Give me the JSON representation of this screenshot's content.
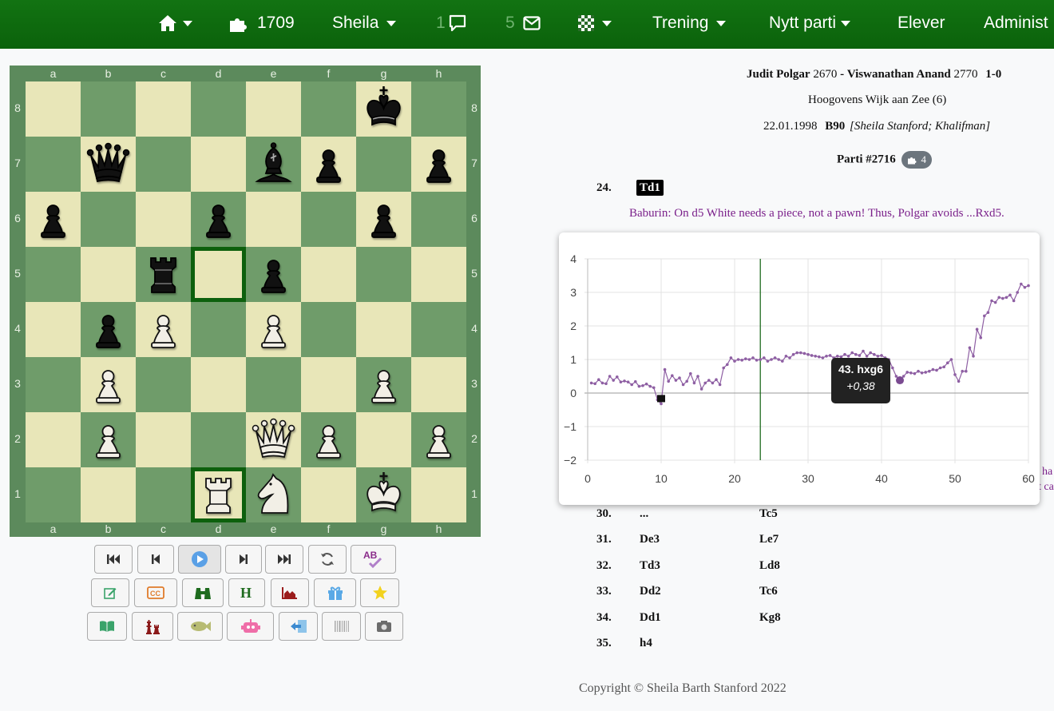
{
  "navbar": {
    "puzzle_count": "1709",
    "user": "Sheila",
    "chat_count": "1",
    "mail_count": "5",
    "training": "Trening",
    "new_game": "Nytt parti",
    "students": "Elever",
    "admin": "Administ"
  },
  "board": {
    "files": [
      "a",
      "b",
      "c",
      "d",
      "e",
      "f",
      "g",
      "h"
    ],
    "ranks": [
      "8",
      "7",
      "6",
      "5",
      "4",
      "3",
      "2",
      "1"
    ],
    "highlight": [
      "d5",
      "d1"
    ],
    "pieces": [
      {
        "sq": "g8",
        "p": "bK"
      },
      {
        "sq": "b7",
        "p": "bQ"
      },
      {
        "sq": "e7",
        "p": "bB"
      },
      {
        "sq": "f7",
        "p": "bP"
      },
      {
        "sq": "h7",
        "p": "bP"
      },
      {
        "sq": "a6",
        "p": "bP"
      },
      {
        "sq": "d6",
        "p": "bP"
      },
      {
        "sq": "g6",
        "p": "bP"
      },
      {
        "sq": "c5",
        "p": "bR"
      },
      {
        "sq": "e5",
        "p": "bP"
      },
      {
        "sq": "b4",
        "p": "bP"
      },
      {
        "sq": "c4",
        "p": "wP"
      },
      {
        "sq": "e4",
        "p": "wP"
      },
      {
        "sq": "b3",
        "p": "wP"
      },
      {
        "sq": "g3",
        "p": "wP"
      },
      {
        "sq": "b2",
        "p": "wP"
      },
      {
        "sq": "e2",
        "p": "wQ"
      },
      {
        "sq": "f2",
        "p": "wP"
      },
      {
        "sq": "h2",
        "p": "wP"
      },
      {
        "sq": "d1",
        "p": "wR"
      },
      {
        "sq": "e1",
        "p": "wN"
      },
      {
        "sq": "g1",
        "p": "wK"
      }
    ]
  },
  "game": {
    "white": "Judit Polgar",
    "white_elo": "2670",
    "black": "Viswanathan Anand",
    "black_elo": "2770",
    "result": "1-0",
    "event": "Hoogovens Wijk aan Zee (6)",
    "date": "22.01.1998",
    "eco": "B90",
    "annotators": "[Sheila Stanford; Khalifman]",
    "game_label": "Parti #2716",
    "puzzle_badge": "4",
    "current_move_no": "24.",
    "current_move": "Td1",
    "comment": "Baburin: On d5 White needs a piece, not a pawn! Thus, Polgar avoids ...Rxd5.",
    "edge_text_1": "ha",
    "edge_text_2": "t ca",
    "moves": [
      {
        "no": "30.",
        "white": "...",
        "black": "Tc5"
      },
      {
        "no": "31.",
        "white": "De3",
        "black": "Le7"
      },
      {
        "no": "32.",
        "white": "Td3",
        "black": "Ld8"
      },
      {
        "no": "33.",
        "white": "Dd2",
        "black": "Tc6"
      },
      {
        "no": "34.",
        "white": "Dd1",
        "black": "Kg8"
      },
      {
        "no": "35.",
        "white": "h4",
        "black": ""
      }
    ]
  },
  "chart_data": {
    "type": "line",
    "title": "",
    "xlabel": "",
    "ylabel": "",
    "xlim": [
      0,
      60
    ],
    "ylim": [
      -2,
      4
    ],
    "xticks": [
      "0",
      "10",
      "20",
      "30",
      "40",
      "50",
      "60"
    ],
    "yticks": [
      "4",
      "3",
      "2",
      "1",
      "0",
      "−1",
      "−2"
    ],
    "current_ply_marker": 23.5,
    "low_point_marker": {
      "x": 10,
      "y": -0.2
    },
    "tooltip": {
      "title": "43. hxg6",
      "value": "+0,38",
      "x": 42.5,
      "y": 0.38
    },
    "color": "#8e5fa3",
    "series": [
      {
        "values": [
          [
            0.5,
            0.3
          ],
          [
            1,
            0.28
          ],
          [
            1.5,
            0.4
          ],
          [
            2,
            0.3
          ],
          [
            2.5,
            0.28
          ],
          [
            3,
            0.5
          ],
          [
            3.5,
            0.38
          ],
          [
            4,
            0.48
          ],
          [
            4.5,
            0.33
          ],
          [
            5,
            0.36
          ],
          [
            5.5,
            0.33
          ],
          [
            6,
            0.25
          ],
          [
            6.5,
            0.34
          ],
          [
            7,
            0.2
          ],
          [
            7.5,
            0.22
          ],
          [
            8,
            0.27
          ],
          [
            8.5,
            0.2
          ],
          [
            9,
            0.16
          ],
          [
            9.5,
            -0.2
          ],
          [
            10,
            -0.32
          ],
          [
            10.5,
            0.7
          ],
          [
            11,
            0.35
          ],
          [
            11.5,
            0.52
          ],
          [
            12,
            0.38
          ],
          [
            12.5,
            0.45
          ],
          [
            13,
            0.25
          ],
          [
            13.5,
            0.35
          ],
          [
            14,
            0.58
          ],
          [
            14.5,
            0.3
          ],
          [
            15,
            0.5
          ],
          [
            15.5,
            0.12
          ],
          [
            16,
            0.3
          ],
          [
            16.5,
            0.38
          ],
          [
            17,
            0.3
          ],
          [
            17.5,
            0.4
          ],
          [
            18,
            0.25
          ],
          [
            18.5,
            0.75
          ],
          [
            19,
            0.85
          ],
          [
            19.5,
            1.05
          ],
          [
            20,
            0.95
          ],
          [
            20.5,
            1.0
          ],
          [
            21,
            0.98
          ],
          [
            21.5,
            1.02
          ],
          [
            22,
            1.0
          ],
          [
            22.5,
            1.05
          ],
          [
            23,
            0.98
          ],
          [
            23.5,
            1.0
          ],
          [
            24,
            1.05
          ],
          [
            24.5,
            0.95
          ],
          [
            25,
            1.0
          ],
          [
            25.5,
            1.05
          ],
          [
            26,
            1.0
          ],
          [
            26.5,
            0.95
          ],
          [
            27,
            1.1
          ],
          [
            27.5,
            1.05
          ],
          [
            28,
            1.15
          ],
          [
            28.5,
            1.2
          ],
          [
            29,
            1.2
          ],
          [
            29.5,
            1.18
          ],
          [
            30,
            1.15
          ],
          [
            30.5,
            1.12
          ],
          [
            31,
            1.1
          ],
          [
            31.5,
            1.08
          ],
          [
            32,
            1.05
          ],
          [
            32.5,
            1.1
          ],
          [
            33,
            1.12
          ],
          [
            33.5,
            1.05
          ],
          [
            34,
            1.1
          ],
          [
            34.5,
            1.08
          ],
          [
            35,
            1.15
          ],
          [
            35.5,
            1.1
          ],
          [
            36,
            1.2
          ],
          [
            36.5,
            1.15
          ],
          [
            37,
            1.12
          ],
          [
            37.5,
            1.25
          ],
          [
            38,
            1.1
          ],
          [
            38.5,
            1.2
          ],
          [
            39,
            1.15
          ],
          [
            39.5,
            1.1
          ],
          [
            40,
            1.12
          ],
          [
            40.5,
            1.05
          ],
          [
            41,
            1.0
          ],
          [
            41.5,
            0.75
          ],
          [
            42,
            0.5
          ],
          [
            42.5,
            0.38
          ],
          [
            43,
            0.5
          ],
          [
            43.5,
            0.62
          ],
          [
            44,
            0.6
          ],
          [
            44.5,
            0.58
          ],
          [
            45,
            0.65
          ],
          [
            45.5,
            0.6
          ],
          [
            46,
            0.62
          ],
          [
            46.5,
            0.65
          ],
          [
            47,
            0.7
          ],
          [
            47.5,
            0.68
          ],
          [
            48,
            0.75
          ],
          [
            48.5,
            0.78
          ],
          [
            49,
            0.9
          ],
          [
            49.5,
            1.0
          ],
          [
            50,
            0.55
          ],
          [
            50.5,
            0.35
          ],
          [
            51,
            0.65
          ],
          [
            51.5,
            0.65
          ],
          [
            52,
            1.35
          ],
          [
            52.5,
            1.1
          ],
          [
            53,
            1.9
          ],
          [
            53.5,
            1.65
          ],
          [
            54,
            2.3
          ],
          [
            54.5,
            2.4
          ],
          [
            55,
            2.75
          ],
          [
            55.5,
            2.7
          ],
          [
            56,
            2.85
          ],
          [
            56.5,
            2.82
          ],
          [
            57,
            2.85
          ],
          [
            57.5,
            2.92
          ],
          [
            58,
            2.75
          ],
          [
            58.5,
            3.0
          ],
          [
            59,
            3.25
          ],
          [
            59.5,
            3.15
          ],
          [
            60,
            3.2
          ]
        ]
      }
    ]
  },
  "footer": {
    "copyright": "Copyright © Sheila Barth Stanford 2022"
  },
  "colors": {
    "nav": "#0b620b",
    "light_square": "#e8e6b8",
    "dark_square": "#6f9c6a",
    "comment": "#7a1f8a",
    "line": "#8e5fa3"
  }
}
